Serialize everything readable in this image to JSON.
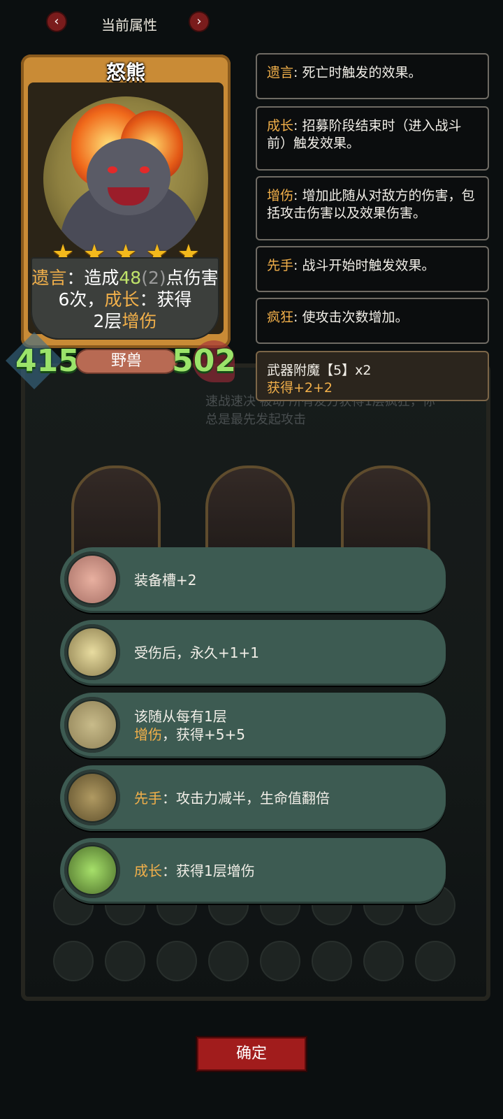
{
  "header": {
    "title": "当前属性",
    "prev_icon": "chevron-left-icon",
    "next_icon": "chevron-right-icon"
  },
  "card": {
    "name": "怒熊",
    "stars": 5,
    "text": {
      "p1": "遗言",
      "p2": "：造成",
      "dmg": "48",
      "dmg_extra": "(2)",
      "p3": "点伤害6次，",
      "p4": "成长",
      "p5": "：获得",
      "p6": "2层",
      "p7": "增伤"
    },
    "attack": "415",
    "health": "502",
    "tribe": "野兽"
  },
  "background": {
    "ghost_text_1": "速战速决 被动 所有友方获得1层疯狂，你",
    "ghost_text_2": "总是最先发起攻击"
  },
  "tooltips": [
    {
      "keyword": "遗言",
      "desc": ": 死亡时触发的效果。"
    },
    {
      "keyword": "成长",
      "desc": ": 招募阶段结束时（进入战斗前）触发效果。"
    },
    {
      "keyword": "增伤",
      "desc": ": 增加此随从对敌方的伤害，包括攻击伤害以及效果伤害。"
    },
    {
      "keyword": "先手",
      "desc": ": 战斗开始时触发效果。"
    },
    {
      "keyword": "疯狂",
      "desc": ": 使攻击次数增加。"
    }
  ],
  "enchant": {
    "title": "武器附魔【5】x2",
    "desc": "获得+2+2"
  },
  "relics": [
    {
      "icon": "pig-icon",
      "line1_kw": "",
      "line1": "装备槽+2",
      "line2_kw": "",
      "line2": ""
    },
    {
      "icon": "candelabra-icon",
      "line1_kw": "",
      "line1": "受伤后，永久+1+1",
      "line2_kw": "",
      "line2": ""
    },
    {
      "icon": "bat-icon",
      "line1_kw": "",
      "line1": "该随从每有1层",
      "line2_kw": "增伤",
      "line2": "，获得+5+5"
    },
    {
      "icon": "armor-icon",
      "line1_kw": "先手",
      "line1": "：攻击力减半，生命值翻倍",
      "line2_kw": "",
      "line2": ""
    },
    {
      "icon": "crystal-icon",
      "line1_kw": "成长",
      "line1": "：获得1层增伤",
      "line2_kw": "",
      "line2": ""
    }
  ],
  "confirm_label": "确定",
  "colors": {
    "keyword": "#f2b04a",
    "stat": "#9be36a",
    "relic_bg": "#3d5b52",
    "confirm": "#a11c1c"
  }
}
